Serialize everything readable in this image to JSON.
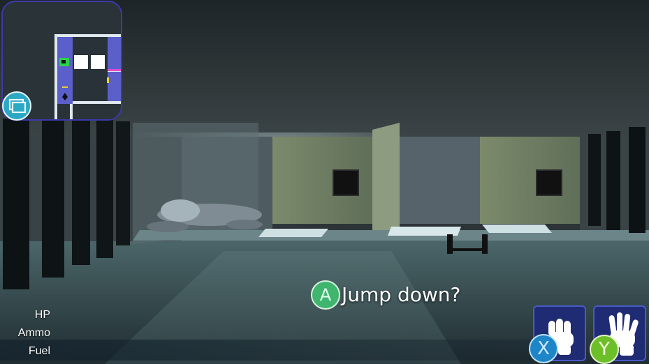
{
  "hud": {
    "stats": [
      {
        "label": "HP"
      },
      {
        "label": "Ammo"
      },
      {
        "label": "Fuel"
      }
    ]
  },
  "prompt": {
    "button": "A",
    "text": "Jump down?"
  },
  "actions": {
    "x_button": "X",
    "y_button": "Y",
    "x_icon": "fist-icon",
    "y_icon": "open-hand-icon"
  },
  "minimap": {
    "toggle_icon": "windows-icon",
    "player_icon": "player-marker-icon"
  },
  "colors": {
    "button_a": "#3fb56e",
    "button_x": "#1e86c8",
    "button_y": "#6dbf2a",
    "minimap_border": "#3b3aa8",
    "minimap_room": "#5b5fc9"
  }
}
